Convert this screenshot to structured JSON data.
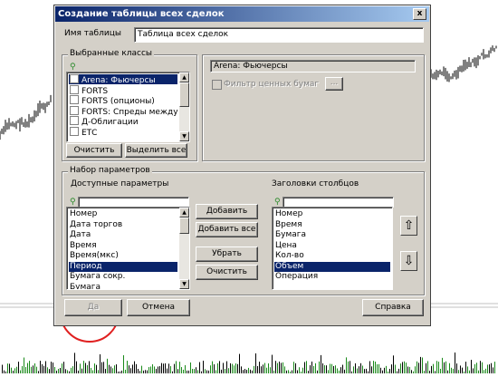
{
  "dialog": {
    "title": "Создание таблицы всех сделок",
    "close_label": "x",
    "table_name_label": "Имя таблицы",
    "table_name_value": "Таблица всех сделок",
    "classes_group": {
      "title": "Выбранные классы",
      "items": [
        {
          "label": "Arena: Фьючерсы",
          "selected": true
        },
        {
          "label": "FORTS",
          "selected": false
        },
        {
          "label": "FORTS (опционы)",
          "selected": false
        },
        {
          "label": "FORTS: Спреды между с",
          "selected": false
        },
        {
          "label": "Д-Облигации",
          "selected": false
        },
        {
          "label": "ЕТС",
          "selected": false
        }
      ],
      "clear_button": "Очистить",
      "select_all_button": "Выделить все"
    },
    "class_info": "Arena: Фьючерсы",
    "securities_filter_label": "Фильтр ценных бумаг",
    "securities_filter_button": "...",
    "params_group": {
      "title": "Набор параметров",
      "available_label": "Доступные параметры",
      "available_items": [
        {
          "label": "Номер",
          "selected": false
        },
        {
          "label": "Дата торгов",
          "selected": false
        },
        {
          "label": "Дата",
          "selected": false
        },
        {
          "label": "Время",
          "selected": false
        },
        {
          "label": "Время(мкс)",
          "selected": false
        },
        {
          "label": "Период",
          "selected": true
        },
        {
          "label": "Бумага сокр.",
          "selected": false
        },
        {
          "label": "Бумага",
          "selected": false
        }
      ],
      "add_button": "Добавить",
      "add_all_button": "Добавить все",
      "remove_button": "Убрать",
      "clear_button": "Очистить",
      "columns_label": "Заголовки столбцов",
      "column_items": [
        {
          "label": "Номер",
          "selected": false
        },
        {
          "label": "Время",
          "selected": false
        },
        {
          "label": "Бумага",
          "selected": false
        },
        {
          "label": "Цена",
          "selected": false
        },
        {
          "label": "Кол-во",
          "selected": false
        },
        {
          "label": "Объем",
          "selected": true
        },
        {
          "label": "Операция",
          "selected": false
        }
      ],
      "move_up_icon": "up-arrow",
      "move_down_icon": "down-arrow"
    },
    "ok_button": "Да",
    "cancel_button": "Отмена",
    "help_button": "Справка"
  },
  "colors": {
    "title_start": "#0a246a",
    "title_end": "#a6caf0",
    "selection": "#0a246a",
    "highlight_circle": "#e02020",
    "volume_bars": "#1a8a1a"
  }
}
